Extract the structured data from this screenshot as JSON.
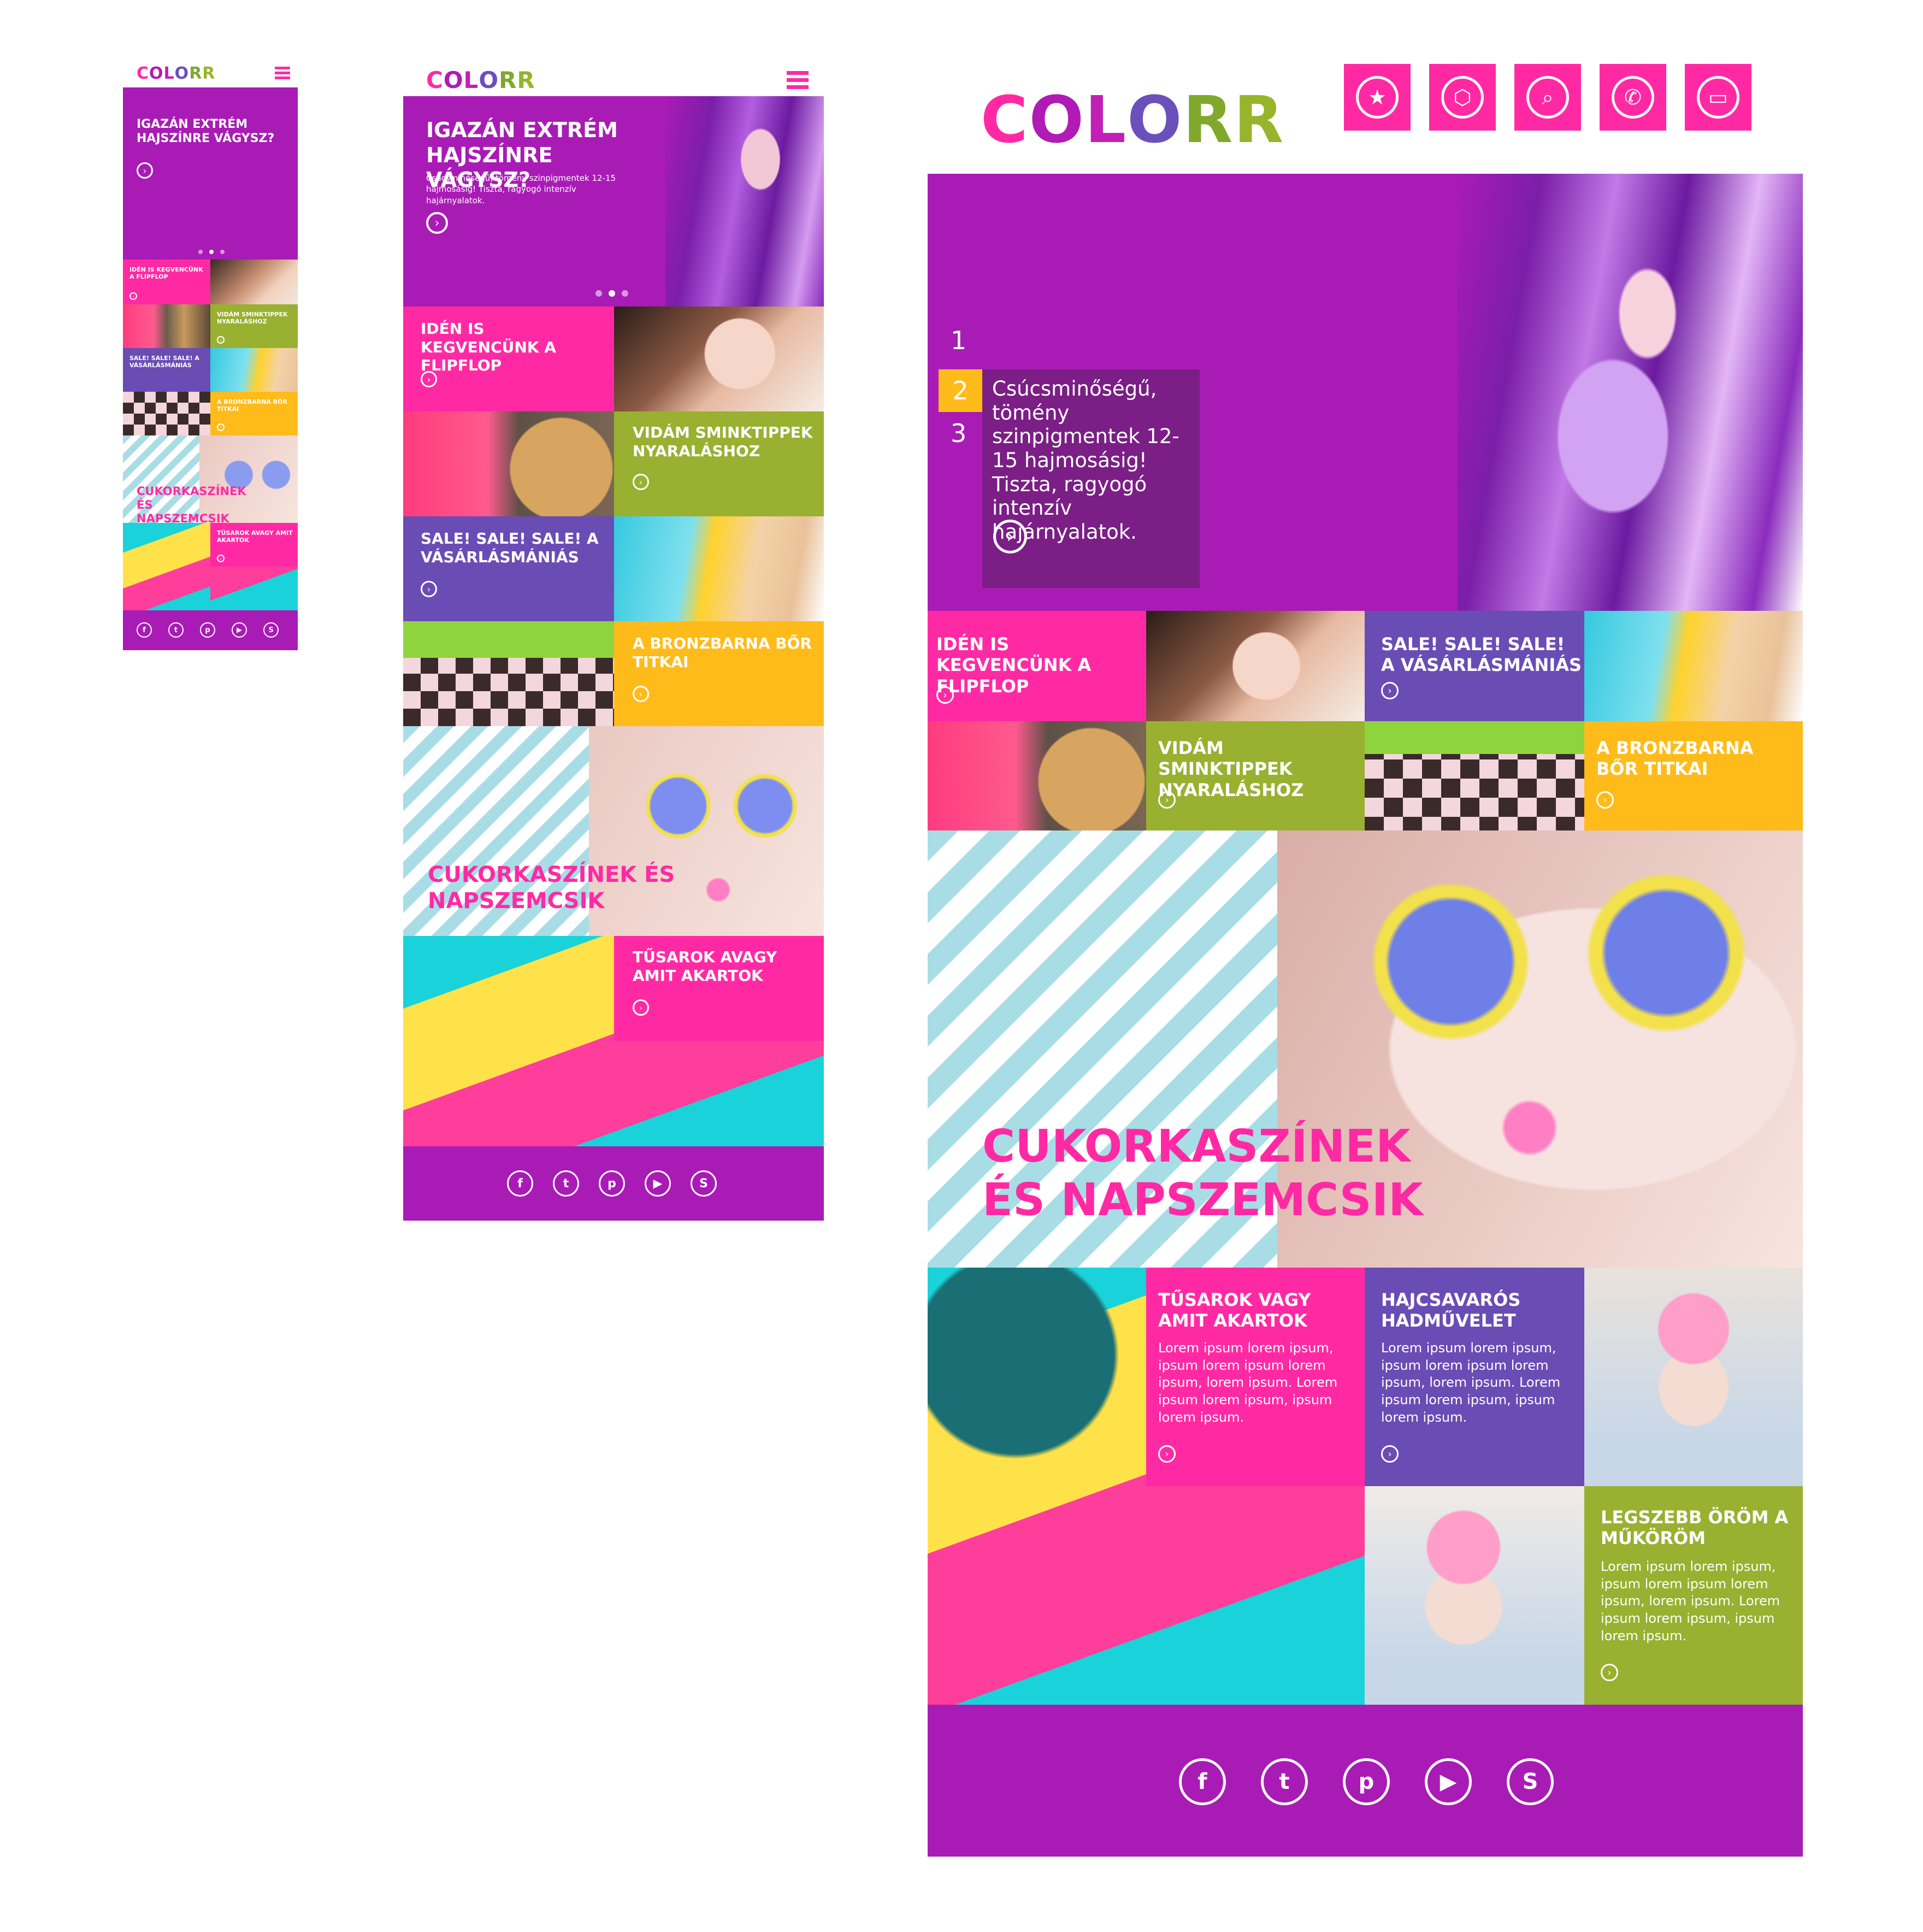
{
  "brand": {
    "letters": [
      {
        "char": "C",
        "color": "#ff2aa3"
      },
      {
        "char": "O",
        "color": "#b01ab5"
      },
      {
        "char": "L",
        "color": "#c11fb5"
      },
      {
        "char": "O",
        "color": "#6b4fbb"
      },
      {
        "char": "R",
        "color": "#7fa82c"
      },
      {
        "char": "R",
        "color": "#98b42a"
      }
    ]
  },
  "colors": {
    "purple": "#a91bb5",
    "pink": "#ff2aa3",
    "green": "#99b030",
    "violet": "#6a4cb5",
    "yellow": "#ffbb1a",
    "cyan": "#1bd6dc"
  },
  "hero": {
    "title": "IGAZÁN EXTRÉM HAJSZÍNRE VÁGYSZ?",
    "subtitle": "Csúcsminőségű, tömény szinpigmentek 12-15 hajmosásig! Tiszta, ragyogó intenzív hajárnyalatok.",
    "slides": [
      "1",
      "2",
      "3"
    ],
    "active_slide": "2"
  },
  "tiles": {
    "flipflop": "IDÉN IS KEGVENCÜNK A FLIPFLOP",
    "smink": "VIDÁM SMINKTIPPEK NYARALÁSHOZ",
    "sale": "SALE! SALE! SALE! A VÁSÁRLÁSMÁNIÁS",
    "bronz": "A BRONZBARNA BŐR TITKAI",
    "cukor": "CUKORKASZÍNEK ÉS NAPSZEMCSIK",
    "tusarok_mobile": "TŰSAROK AVAGY AMIT AKARTOK",
    "tusarok": "TŰSAROK VAGY AMIT AKARTOK",
    "hajcsavaros": "HAJCSAVARÓS HADMŰVELET",
    "legszebb": "LEGSZEBB ÖRÖM A MŰKÖRÖM",
    "lorem": "Lorem ipsum lorem ipsum, ipsum lorem ipsum lorem ipsum, lorem ipsum. Lorem ipsum lorem ipsum, ipsum lorem ipsum."
  },
  "social": [
    "facebook-icon",
    "twitter-icon",
    "pinterest-icon",
    "youtube-icon",
    "skype-icon"
  ],
  "top_nav_icons": [
    "star-icon",
    "box-icon",
    "search-icon",
    "phone-icon",
    "card-icon"
  ]
}
